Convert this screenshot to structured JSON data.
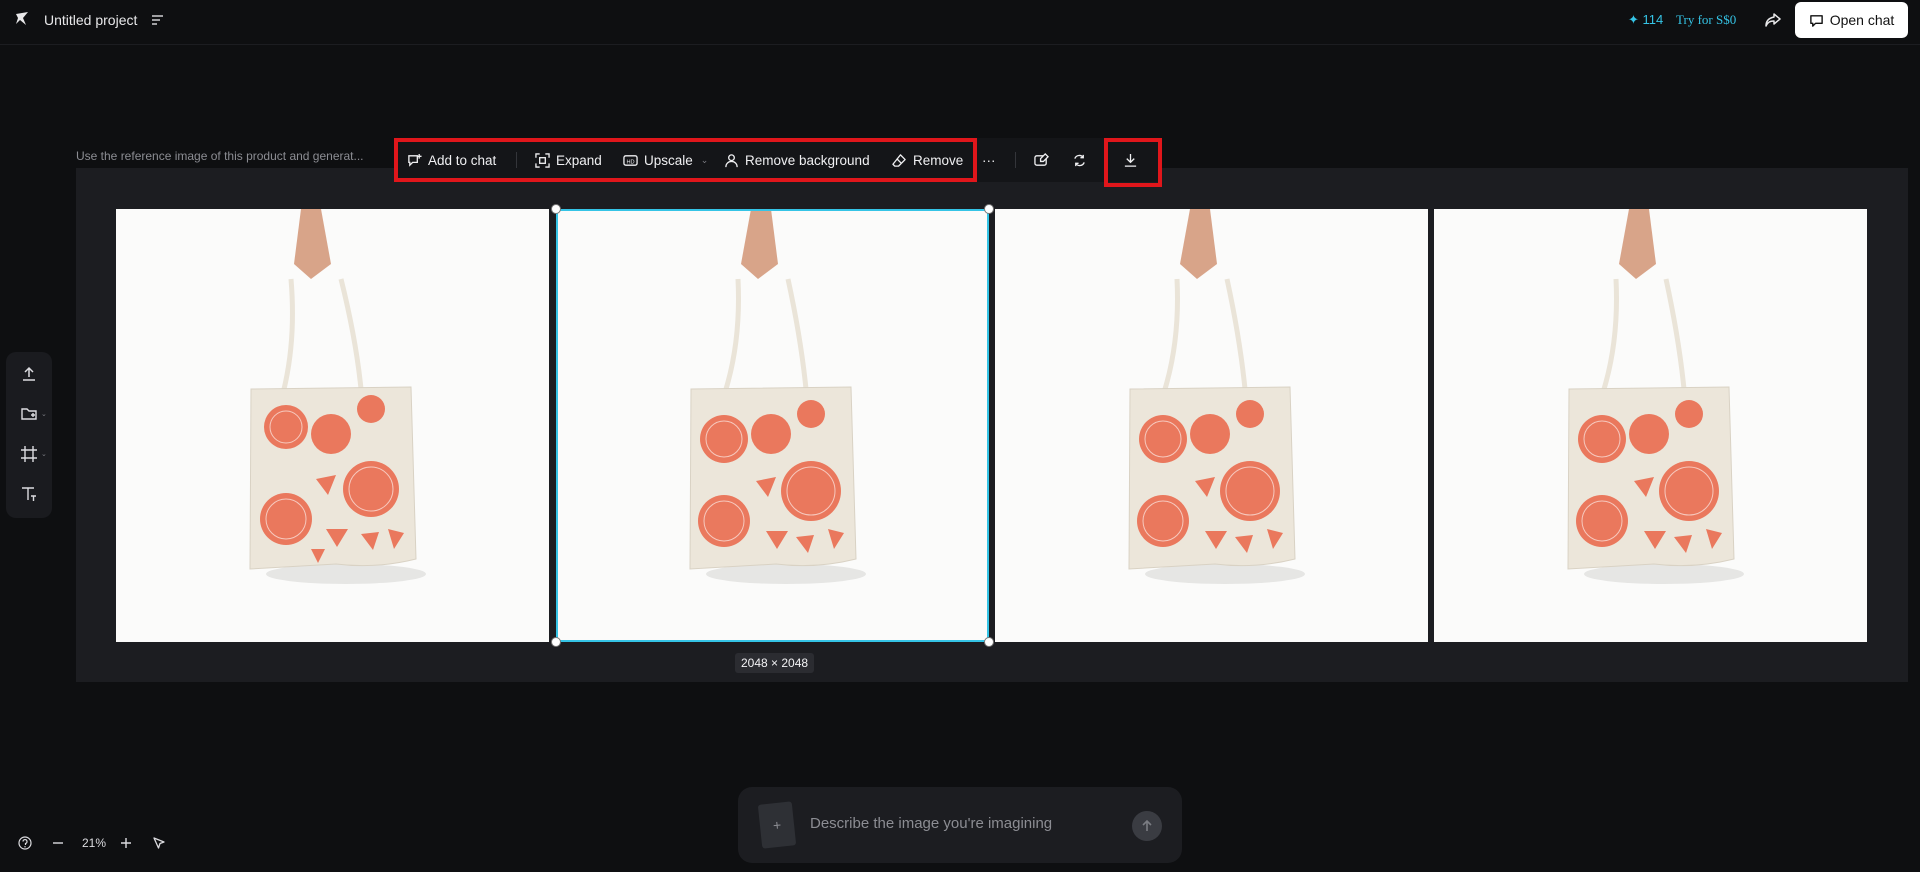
{
  "header": {
    "project_title": "Untitled project",
    "credits": "✦ 114",
    "try_label": "Try for S$0",
    "open_chat_label": "Open chat",
    "icons": [
      "logo-icon",
      "menu-icon",
      "share-icon",
      "chat-icon"
    ]
  },
  "prompt_caption": "Use the reference image of this product and generat...",
  "toolbar": {
    "add_to_chat": "Add to chat",
    "expand": "Expand",
    "upscale": "Upscale",
    "remove_background": "Remove background",
    "remove": "Remove",
    "more": "···"
  },
  "canvas": {
    "selected_dimensions": "2048 × 2048",
    "selected_index": 2,
    "image_count": 4,
    "selection_color": "#35c4e6",
    "highlight_color": "#e0161b"
  },
  "chat": {
    "placeholder": "Describe the image you're imagining",
    "attach_symbol": "+"
  },
  "zoom": {
    "level": "21%"
  },
  "colors": {
    "background": "#0e0f11",
    "panel": "#1c1d21",
    "accent": "#35c4e6"
  }
}
